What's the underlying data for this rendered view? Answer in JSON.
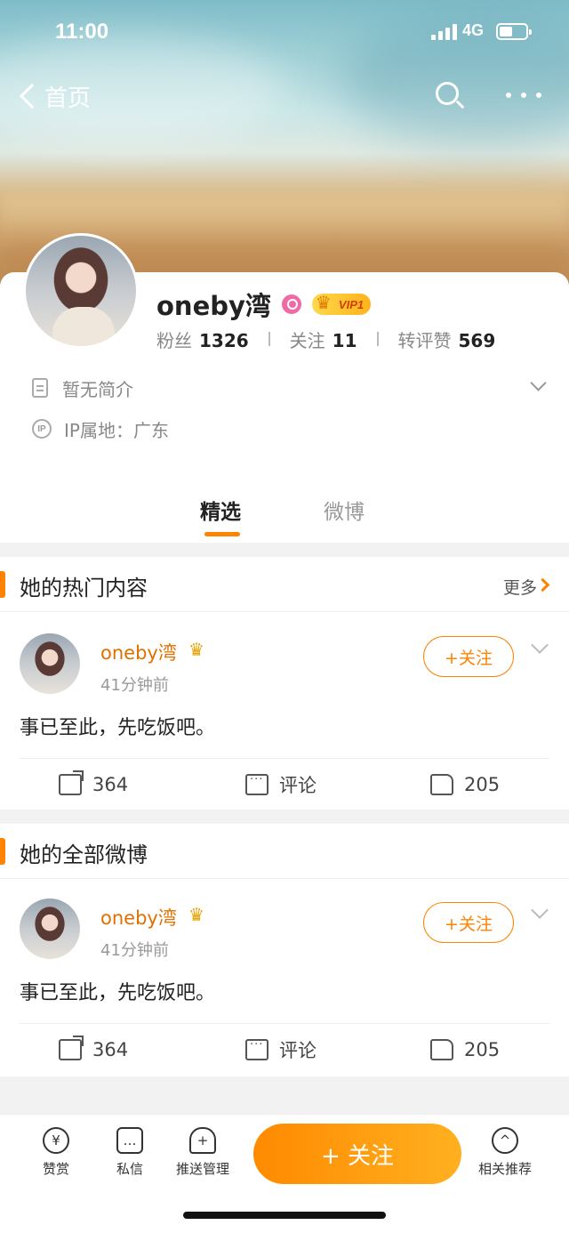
{
  "status_bar": {
    "time": "11:00",
    "network": "4G"
  },
  "nav": {
    "back_label": "首页"
  },
  "profile": {
    "name": "oneby湾",
    "vip_label": "VIP1",
    "stats": [
      {
        "label": "粉丝",
        "value": "1326"
      },
      {
        "label": "关注",
        "value": "11"
      },
      {
        "label": "转评赞",
        "value": "569"
      }
    ],
    "bio": "暂无简介",
    "ip_location": "IP属地：广东"
  },
  "tabs": [
    {
      "label": "精选",
      "active": true
    },
    {
      "label": "微博",
      "active": false
    }
  ],
  "sections": [
    {
      "title": "她的热门内容",
      "more_label": "更多",
      "post": {
        "author": "oneby湾",
        "time": "41分钟前",
        "follow_label": "+关注",
        "text": "事已至此，先吃饭吧。",
        "reposts": "364",
        "comments_label": "评论",
        "likes": "205"
      }
    },
    {
      "title": "她的全部微博",
      "post": {
        "author": "oneby湾",
        "time": "41分钟前",
        "follow_label": "+关注",
        "text": "事已至此，先吃饭吧。",
        "reposts": "364",
        "comments_label": "评论",
        "likes": "205"
      }
    }
  ],
  "bottom_bar": {
    "reward": "赞赏",
    "message": "私信",
    "push": "推送管理",
    "follow": "+ 关注",
    "recommend": "相关推荐"
  },
  "colors": {
    "accent": "#ff8200",
    "name": "#e07000"
  }
}
